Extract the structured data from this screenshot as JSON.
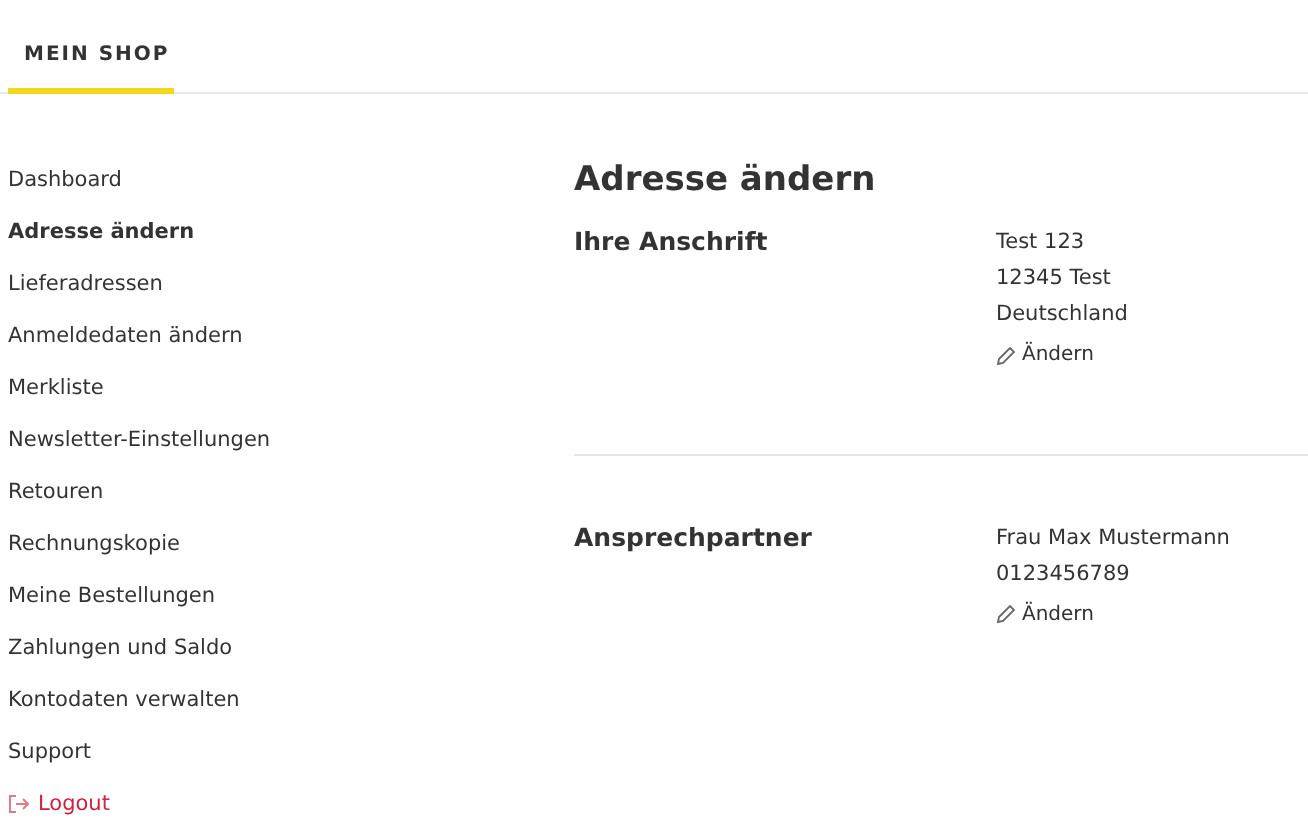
{
  "tabs": [
    {
      "label": "MEIN SHOP",
      "selected": true
    }
  ],
  "sidebar": {
    "items": [
      {
        "label": "Dashboard",
        "kind": "link",
        "selected": false
      },
      {
        "label": "Adresse ändern",
        "kind": "link",
        "selected": true
      },
      {
        "label": "Lieferadressen",
        "kind": "link",
        "selected": false
      },
      {
        "label": "Anmeldedaten ändern",
        "kind": "link",
        "selected": false
      },
      {
        "label": "Merkliste",
        "kind": "link",
        "selected": false
      },
      {
        "label": "Newsletter-Einstellungen",
        "kind": "link",
        "selected": false
      },
      {
        "label": "Retouren",
        "kind": "link",
        "selected": false
      },
      {
        "label": "Rechnungskopie",
        "kind": "link",
        "selected": false
      },
      {
        "label": "Meine Bestellungen",
        "kind": "link",
        "selected": false
      },
      {
        "label": "Zahlungen und Saldo",
        "kind": "link",
        "selected": false
      },
      {
        "label": "Kontodaten verwalten",
        "kind": "link",
        "selected": false
      },
      {
        "label": "Support",
        "kind": "link",
        "selected": false
      },
      {
        "label": "Logout",
        "kind": "logout",
        "selected": false
      }
    ]
  },
  "main": {
    "title": "Adresse ändern",
    "sections": [
      {
        "heading": "Ihre Anschrift",
        "lines": [
          "Test 123",
          "12345 Test",
          "Deutschland"
        ],
        "action": "Ändern"
      },
      {
        "heading": "Ansprechpartner",
        "lines": [
          "Frau Max Mustermann",
          "0123456789"
        ],
        "action": "Ändern"
      }
    ]
  }
}
